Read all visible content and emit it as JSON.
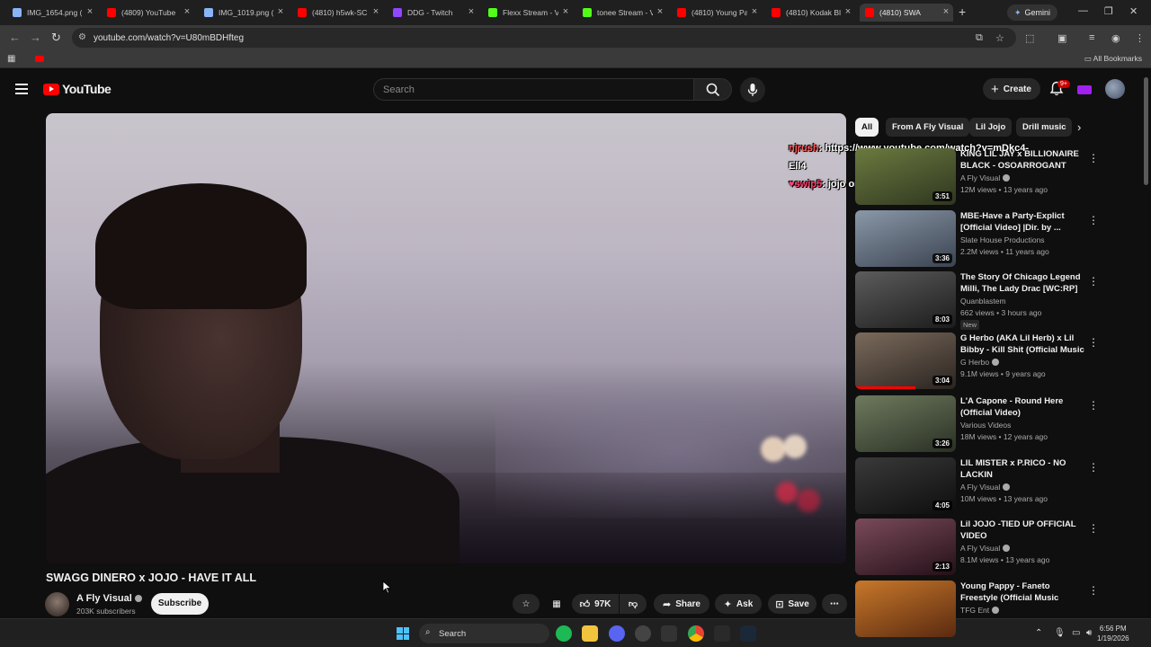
{
  "browser": {
    "tabs": [
      {
        "title": "IMG_1654.png (",
        "favicon_color": "#8ab4f8"
      },
      {
        "title": "(4809) YouTube",
        "favicon_color": "#ff0000"
      },
      {
        "title": "IMG_1019.png (",
        "favicon_color": "#8ab4f8"
      },
      {
        "title": "(4810) h5wk-SC",
        "favicon_color": "#ff0000"
      },
      {
        "title": "DDG - Twitch",
        "favicon_color": "#9146ff"
      },
      {
        "title": "Flexx Stream - V",
        "favicon_color": "#53fc18"
      },
      {
        "title": "tonee Stream - V",
        "favicon_color": "#53fc18"
      },
      {
        "title": "(4810) Young Pa",
        "favicon_color": "#ff0000"
      },
      {
        "title": "(4810) Kodak Bla",
        "favicon_color": "#ff0000"
      },
      {
        "title": "(4810) SWA",
        "favicon_color": "#ff0000"
      }
    ],
    "new_tab": "+",
    "gemini_label": "Gemini",
    "url": "youtube.com/watch?v=U80mBDHfteg",
    "all_bookmarks": "All Bookmarks"
  },
  "masthead": {
    "logo_text": "YouTube",
    "search_placeholder": "Search",
    "create_label": "Create",
    "notifications_badge": "9+"
  },
  "player": {
    "chat": [
      {
        "user": "njrush",
        "message": "https://www.youtube.com/watch?v=mDkc4-Ell4"
      },
      {
        "user": "swip5",
        "message": "jojo only good song ldk"
      }
    ]
  },
  "video": {
    "title": "SWAGG DINERO x JOJO - HAVE IT ALL",
    "channel": "A Fly Visual",
    "subscribers": "203K subscribers",
    "subscribe_label": "Subscribe",
    "likes": "97K",
    "share_label": "Share",
    "ask_label": "Ask",
    "save_label": "Save"
  },
  "chips": [
    "All",
    "From A Fly Visual",
    "Lil Jojo",
    "Drill music"
  ],
  "recommendations": [
    {
      "title": "KING LIL JAY x BILLIONAIRE BLACK - OSOARROGANT",
      "channel": "A Fly Visual",
      "verified": true,
      "meta": "12M views • 13 years ago",
      "duration": "3:51",
      "thumb": [
        "#6b7a3f",
        "#2f3620"
      ]
    },
    {
      "title": "MBE-Have a Party-Explict [Official Video] |Dir. by ...",
      "channel": "Slate House Productions",
      "verified": false,
      "meta": "2.2M views • 11 years ago",
      "duration": "3:36",
      "thumb": [
        "#8a98a8",
        "#3b4350"
      ]
    },
    {
      "title": "The Story Of Chicago Legend Milli, The Lady Drac [WC:RP]",
      "channel": "Quanblastem",
      "verified": false,
      "meta": "662 views • 3 hours ago",
      "duration": "8:03",
      "thumb": [
        "#5c5c5c",
        "#1c1c1c"
      ],
      "badge": "New"
    },
    {
      "title": "G Herbo (AKA Lil Herb) x Lil Bibby - Kill Shit (Official Music ...",
      "channel": "G Herbo",
      "verified": true,
      "meta": "9.1M views • 9 years ago",
      "duration": "3:04",
      "thumb": [
        "#7b6a5c",
        "#2a2420"
      ],
      "progress": 0.6
    },
    {
      "title": "L'A Capone - Round Here (Official Video)",
      "channel": "Various Videos",
      "verified": false,
      "meta": "18M views • 12 years ago",
      "duration": "3:26",
      "thumb": [
        "#6e7a5e",
        "#2a3024"
      ]
    },
    {
      "title": "LIL MISTER x P.RICO - NO LACKIN",
      "channel": "A Fly Visual",
      "verified": true,
      "meta": "10M views • 13 years ago",
      "duration": "4:05",
      "thumb": [
        "#3a3a3a",
        "#0d0d0d"
      ]
    },
    {
      "title": "Lil JOJO -TIED UP OFFICIAL VIDEO",
      "channel": "A Fly Visual",
      "verified": true,
      "meta": "8.1M views • 13 years ago",
      "duration": "2:13",
      "thumb": [
        "#7a4a5a",
        "#241018"
      ]
    },
    {
      "title": "Young Pappy - Faneto Freestyle (Official Music Video)",
      "channel": "TFG Ent",
      "verified": true,
      "meta": "",
      "duration": "",
      "thumb": [
        "#c8782a",
        "#5a2a10"
      ]
    }
  ],
  "taskbar": {
    "search_label": "Search",
    "time": "6:56 PM",
    "date": "1/19/2026"
  }
}
